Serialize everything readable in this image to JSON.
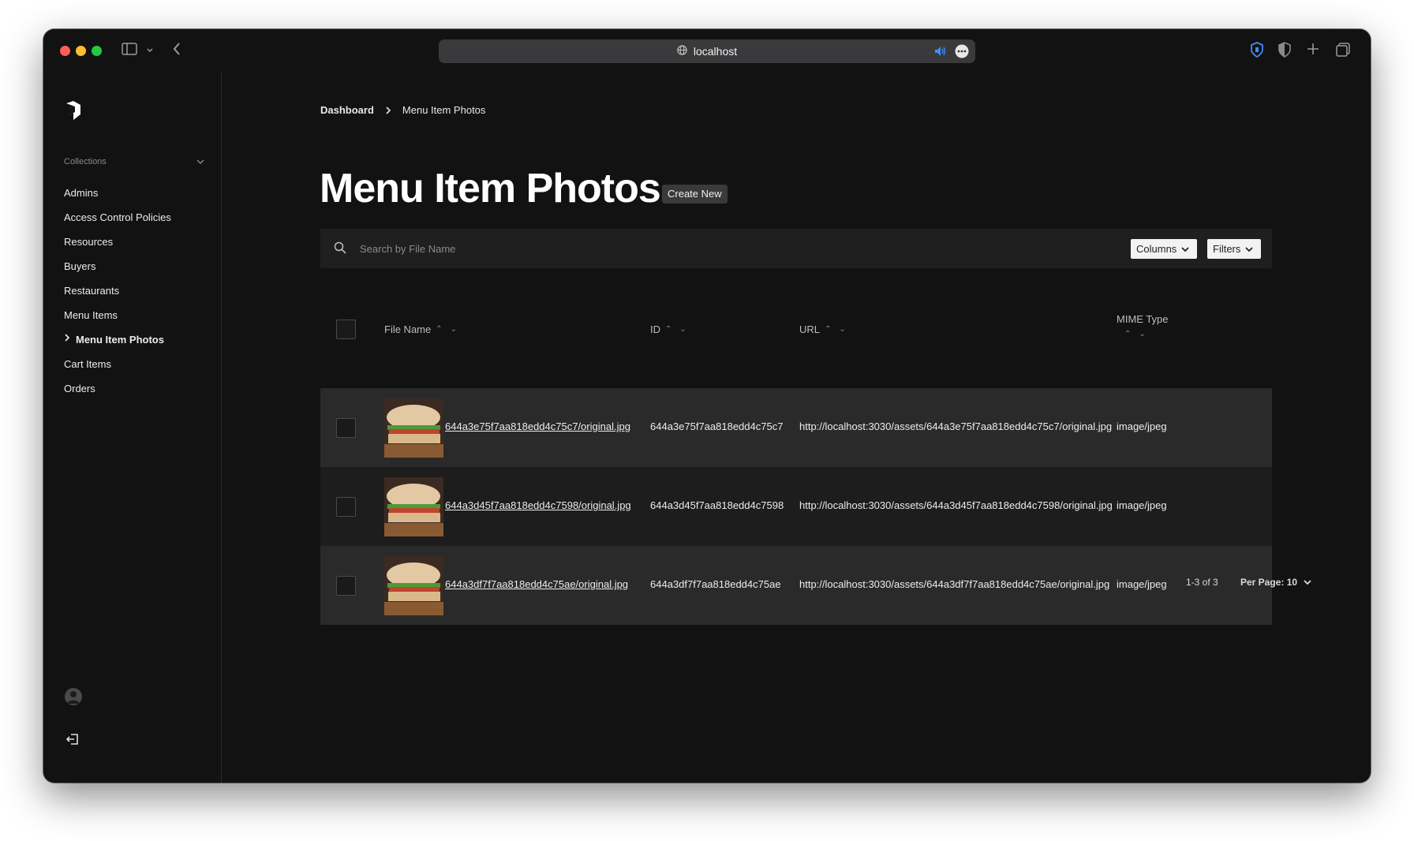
{
  "browser": {
    "url": "localhost"
  },
  "sidebar": {
    "collections_label": "Collections",
    "items": [
      {
        "label": "Admins"
      },
      {
        "label": "Access Control Policies"
      },
      {
        "label": "Resources"
      },
      {
        "label": "Buyers"
      },
      {
        "label": "Restaurants"
      },
      {
        "label": "Menu Items"
      },
      {
        "label": "Menu Item Photos"
      },
      {
        "label": "Cart Items"
      },
      {
        "label": "Orders"
      }
    ],
    "active_index": 6
  },
  "breadcrumb": {
    "root": "Dashboard",
    "current": "Menu Item Photos"
  },
  "header": {
    "title": "Menu Item Photos",
    "create_label": "Create New"
  },
  "search": {
    "placeholder": "Search by File Name",
    "columns_label": "Columns",
    "filters_label": "Filters"
  },
  "table": {
    "columns": [
      "File Name",
      "ID",
      "URL",
      "MIME Type"
    ],
    "rows": [
      {
        "file_name": "644a3e75f7aa818edd4c75c7/original.jpg",
        "id": "644a3e75f7aa818edd4c75c7",
        "url": "http://localhost:3030/assets/644a3e75f7aa818edd4c75c7/original.jpg",
        "mime": "image/jpeg"
      },
      {
        "file_name": "644a3d45f7aa818edd4c7598/original.jpg",
        "id": "644a3d45f7aa818edd4c7598",
        "url": "http://localhost:3030/assets/644a3d45f7aa818edd4c7598/original.jpg",
        "mime": "image/jpeg"
      },
      {
        "file_name": "644a3df7f7aa818edd4c75ae/original.jpg",
        "id": "644a3df7f7aa818edd4c75ae",
        "url": "http://localhost:3030/assets/644a3df7f7aa818edd4c75ae/original.jpg",
        "mime": "image/jpeg"
      }
    ]
  },
  "pagination": {
    "range": "1-3 of 3",
    "per_page": "Per Page: 10"
  }
}
